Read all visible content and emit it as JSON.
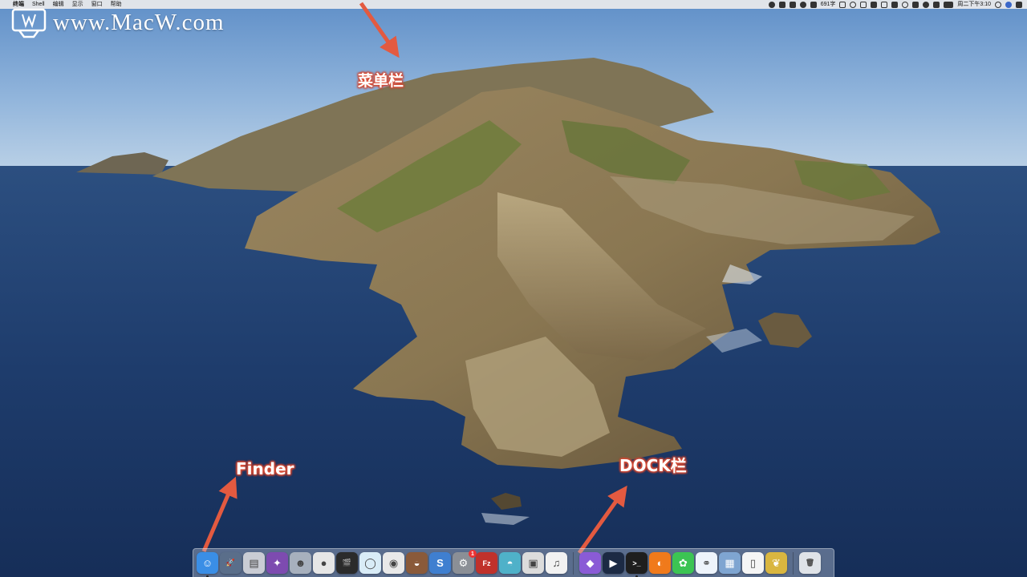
{
  "menubar": {
    "apple_glyph": "",
    "items": [
      "终端",
      "Shell",
      "编辑",
      "显示",
      "窗口",
      "帮助"
    ],
    "status": {
      "memory": "691字",
      "datetime": "周二下午3:10"
    }
  },
  "watermark": {
    "text": "www.MacW.com"
  },
  "annotations": {
    "menubar": "菜单栏",
    "finder": "Finder",
    "dock": "DOCK栏"
  },
  "dock": {
    "apps": [
      {
        "icon": "finder-icon",
        "color": "#3a8ee6",
        "glyph": "☺",
        "running": true
      },
      {
        "icon": "launchpad-icon",
        "color": "#5a6e8a",
        "glyph": "🚀"
      },
      {
        "icon": "printer-icon",
        "color": "#c9ccd4",
        "glyph": "▤"
      },
      {
        "icon": "photo-editor-icon",
        "color": "#7d4bb0",
        "glyph": "✦"
      },
      {
        "icon": "robot-icon",
        "color": "#a7b0bd",
        "glyph": "☻"
      },
      {
        "icon": "photo-booth-icon",
        "color": "#e6e6e6",
        "glyph": "●"
      },
      {
        "icon": "final-cut-icon",
        "color": "#2b2b2b",
        "glyph": "🎬"
      },
      {
        "icon": "search-app-icon",
        "color": "#d9ecf7",
        "glyph": "◯"
      },
      {
        "icon": "chrome-icon",
        "color": "#e9e9e9",
        "glyph": "◉"
      },
      {
        "icon": "mail-app-icon",
        "color": "#8a5a3a",
        "glyph": "◒"
      },
      {
        "icon": "scrivener-icon",
        "color": "#3f7fd0",
        "glyph": "S"
      },
      {
        "icon": "system-preferences-icon",
        "color": "#8b8f96",
        "glyph": "⚙",
        "badge": "1"
      },
      {
        "icon": "filezilla-icon",
        "color": "#c0312b",
        "glyph": "Fz"
      },
      {
        "icon": "photos-app-icon",
        "color": "#4fb1c9",
        "glyph": "◓"
      },
      {
        "icon": "screen-capture-icon",
        "color": "#dcdcdc",
        "glyph": "▣"
      },
      {
        "icon": "music-app-icon",
        "color": "#f2f2f2",
        "glyph": "♫"
      }
    ],
    "apps2": [
      {
        "icon": "shield-app-icon",
        "color": "#8a5bd6",
        "glyph": "◆"
      },
      {
        "icon": "quicktime-icon",
        "color": "#1c2a44",
        "glyph": "▶"
      },
      {
        "icon": "terminal-icon",
        "color": "#1e1e1e",
        "glyph": ">_",
        "running": true
      },
      {
        "icon": "firefox-icon",
        "color": "#f07a1b",
        "glyph": "◐"
      },
      {
        "icon": "wechat-icon",
        "color": "#3cc453",
        "glyph": "✿"
      },
      {
        "icon": "cloud-app-icon",
        "color": "#eef4fb",
        "glyph": "⚭"
      },
      {
        "icon": "preview-icon",
        "color": "#7fa5d1",
        "glyph": "▦"
      },
      {
        "icon": "document-icon",
        "color": "#f5f5f5",
        "glyph": "▯"
      },
      {
        "icon": "pineapple-icon",
        "color": "#d9b640",
        "glyph": "❦"
      }
    ],
    "trash": {
      "icon": "trash-icon",
      "color": "#dfe3e8",
      "glyph": "🗑"
    }
  }
}
